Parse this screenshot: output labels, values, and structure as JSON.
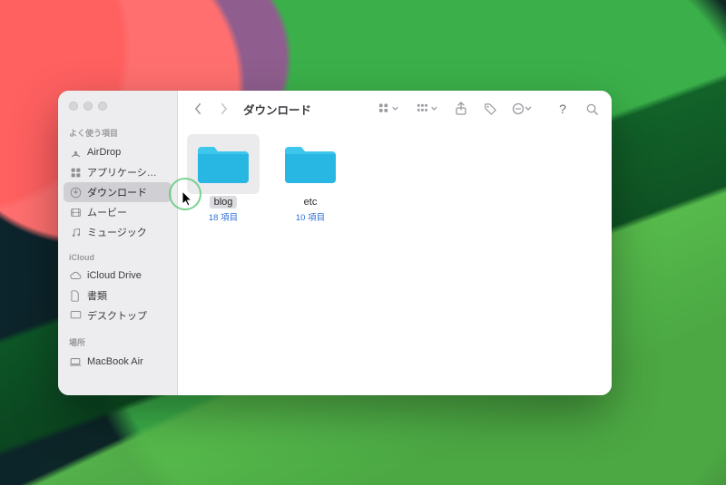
{
  "window": {
    "title": "ダウンロード"
  },
  "sidebar": {
    "sections": [
      {
        "heading": "よく使う項目",
        "items": [
          {
            "icon": "airdrop",
            "label": "AirDrop",
            "selected": false
          },
          {
            "icon": "apps",
            "label": "アプリケーシ…",
            "selected": false
          },
          {
            "icon": "downloads",
            "label": "ダウンロード",
            "selected": true
          },
          {
            "icon": "movies",
            "label": "ムービー",
            "selected": false
          },
          {
            "icon": "music",
            "label": "ミュージック",
            "selected": false
          }
        ]
      },
      {
        "heading": "iCloud",
        "items": [
          {
            "icon": "icloud",
            "label": "iCloud Drive",
            "selected": false
          },
          {
            "icon": "documents",
            "label": "書類",
            "selected": false
          },
          {
            "icon": "desktop",
            "label": "デスクトップ",
            "selected": false
          }
        ]
      },
      {
        "heading": "場所",
        "items": [
          {
            "icon": "laptop",
            "label": "MacBook Air",
            "selected": false
          }
        ]
      }
    ]
  },
  "folders": [
    {
      "name": "blog",
      "meta": "18 項目",
      "selected": true
    },
    {
      "name": "etc",
      "meta": "10 項目",
      "selected": false
    }
  ],
  "toolbar_icons": {
    "back": "back",
    "forward": "forward",
    "view": "grid-view",
    "group": "group-by",
    "share": "share",
    "tag": "tag",
    "more": "more",
    "help": "help",
    "search": "search"
  }
}
